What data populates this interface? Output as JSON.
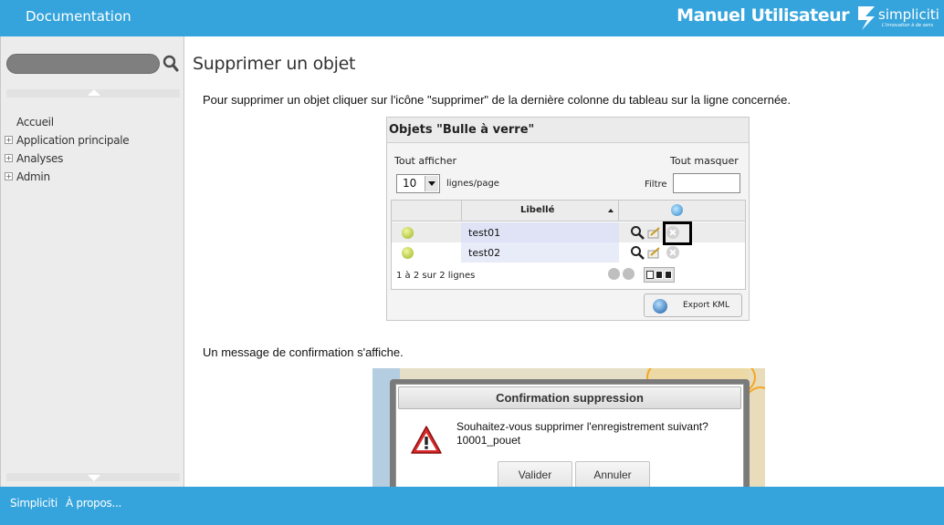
{
  "header": {
    "doc_title": "Documentation",
    "manual_title": "Manuel Utilisateur",
    "logo_name": "simpliciti",
    "logo_tagline": "L'innovation à de sens"
  },
  "sidebar": {
    "search": {
      "value": "",
      "placeholder": ""
    },
    "items": [
      {
        "label": "Accueil",
        "expandable": false
      },
      {
        "label": "Application principale",
        "expandable": true
      },
      {
        "label": "Analyses",
        "expandable": true
      },
      {
        "label": "Admin",
        "expandable": true
      }
    ]
  },
  "main": {
    "title": "Supprimer un objet",
    "intro": "Pour supprimer un objet cliquer sur l'icône \"supprimer\" de la dernière colonne du tableau sur la ligne concernée.",
    "confirm_intro": "Un message de confirmation s'affiche."
  },
  "screenshot1": {
    "title": "Objets \"Bulle à verre\"",
    "show_all": "Tout afficher",
    "hide_all": "Tout masquer",
    "page_size": "10",
    "lines_per_page": "lignes/page",
    "filter_label": "Filtre",
    "column_header": "Libellé",
    "rows": [
      "test01",
      "test02"
    ],
    "pagination": "1 à 2 sur 2 lignes",
    "export_kml": "Export KML"
  },
  "screenshot2": {
    "dialog_title": "Confirmation suppression",
    "message_line1": "Souhaitez-vous supprimer l'enregistrement suivant?",
    "message_line2": "10001_pouet",
    "ok_button": "Valider",
    "cancel_button": "Annuler"
  },
  "footer": {
    "brand_link": "Simpliciti",
    "about_link": "À propos..."
  },
  "colors": {
    "accent": "#35a4dc",
    "sidebar_bg": "#ececec",
    "row_highlight": "#dfe3f5"
  }
}
